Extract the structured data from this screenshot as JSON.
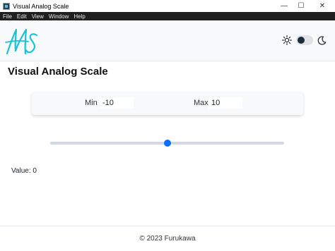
{
  "window": {
    "title": "Visual Analog Scale",
    "controls": {
      "minimize": "—",
      "maximize": "☐",
      "close": "✕"
    }
  },
  "menu": [
    "File",
    "Edit",
    "View",
    "Window",
    "Help"
  ],
  "header": {
    "logo_text": "MS",
    "logo_color": "#19c3d6",
    "theme_toggle": {
      "icons": [
        "sun-icon",
        "moon-icon"
      ],
      "checked": true
    }
  },
  "page": {
    "title": "Visual Analog Scale"
  },
  "range": {
    "min_label": "Min",
    "min_value": "-10",
    "max_label": "Max",
    "max_value": "10"
  },
  "slider": {
    "min": -10,
    "max": 10,
    "value": 0,
    "accent": "#0d6efd"
  },
  "result": {
    "label": "Value:",
    "value": "0"
  },
  "footer": {
    "text": "© 2023 Furukawa"
  }
}
